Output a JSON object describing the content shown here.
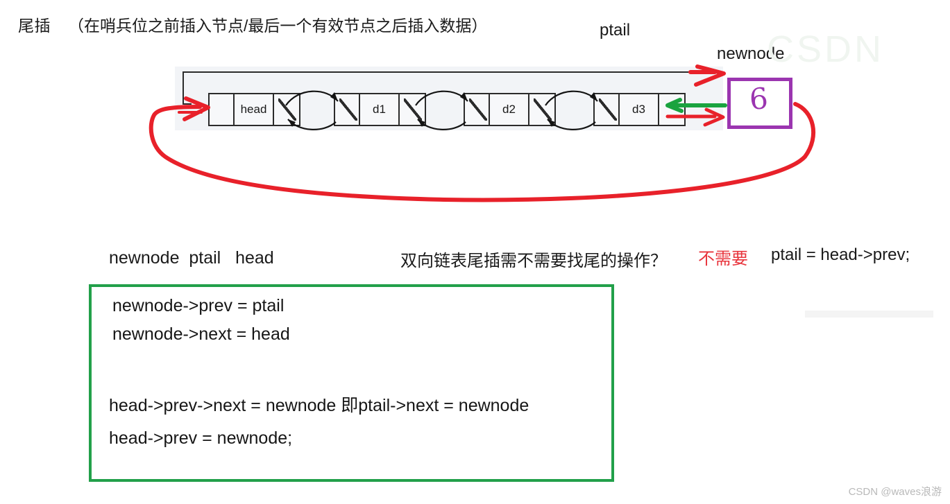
{
  "heading": {
    "label": "尾插",
    "parenthetical": "（在哨兵位之前插入节点/最后一个有效节点之后插入数据）"
  },
  "diagram": {
    "pointer_labels": {
      "ptail": "ptail",
      "newnode": "newnode"
    },
    "nodes": [
      {
        "name": "head-node",
        "data": "head"
      },
      {
        "name": "d1-node",
        "data": "d1"
      },
      {
        "name": "d2-node",
        "data": "d2"
      },
      {
        "name": "d3-node",
        "data": "d3"
      }
    ],
    "newnode_value": "6",
    "colors": {
      "newnode_border": "#9b35b0",
      "new_link_red": "#e8212a",
      "new_link_green": "#1aa33f",
      "node_border": "#2b2b2b",
      "panel_background": "#f2f4f7"
    }
  },
  "notes": {
    "variables": "newnode  ptail   head",
    "question": "双向链表尾插需不需要找尾的操作？",
    "answer": "不需要",
    "ptail_assignment": "ptail = head->prev;"
  },
  "code_box": {
    "border_color": "#22a04a",
    "lines": [
      "newnode->prev = ptail",
      "newnode->next = head",
      "head->prev->next = newnode 即ptail->next = newnode",
      "head->prev = newnode;"
    ]
  },
  "watermark": {
    "text": "CSDN @waves浪游",
    "faint": "CSDN"
  }
}
